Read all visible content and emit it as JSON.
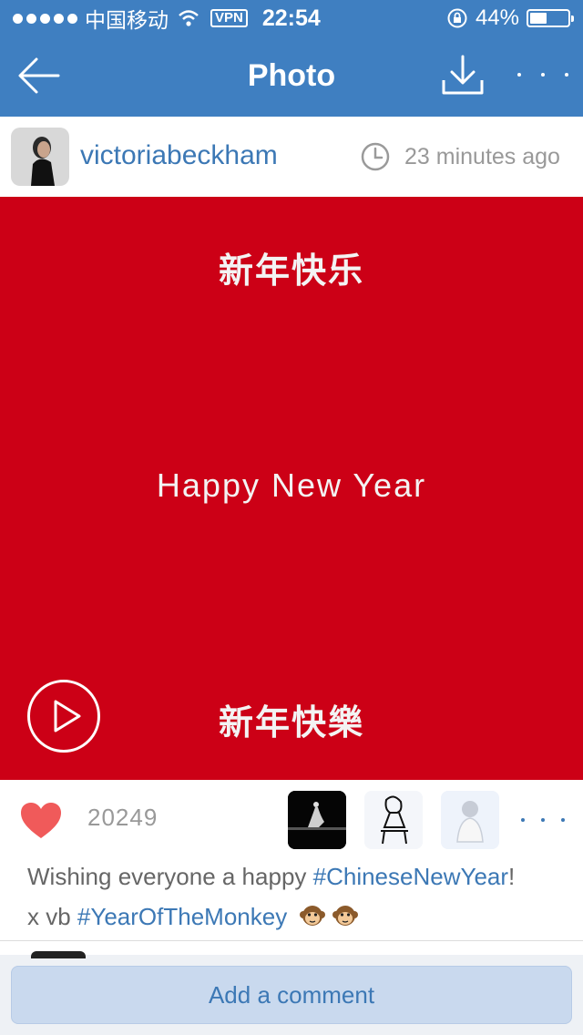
{
  "status_bar": {
    "carrier": "中国移动",
    "vpn": "VPN",
    "time": "22:54",
    "battery_percent": "44%",
    "battery_level": 0.44
  },
  "nav": {
    "title": "Photo",
    "icons": [
      "back-arrow-icon",
      "download-icon",
      "more-icon"
    ]
  },
  "post": {
    "username": "victoriabeckham",
    "time_ago": "23 minutes ago",
    "photo": {
      "line1": "新年快乐",
      "line2": "Happy New Year",
      "line3": "新年快樂",
      "background": "#cc0016"
    },
    "likes_count": "20249",
    "caption": {
      "part1": "Wishing everyone a happy ",
      "hashtag1": "#ChineseNewYear",
      "part2": "!",
      "part3": "x vb ",
      "hashtag2": "#YearOfTheMonkey",
      "emoji": "🐵 🐵"
    }
  },
  "comment": {
    "placeholder": "Add a comment"
  },
  "colors": {
    "brand_blue": "#3f7fc1",
    "link_blue": "#3c78b5",
    "heart_red": "#f05a5a"
  }
}
